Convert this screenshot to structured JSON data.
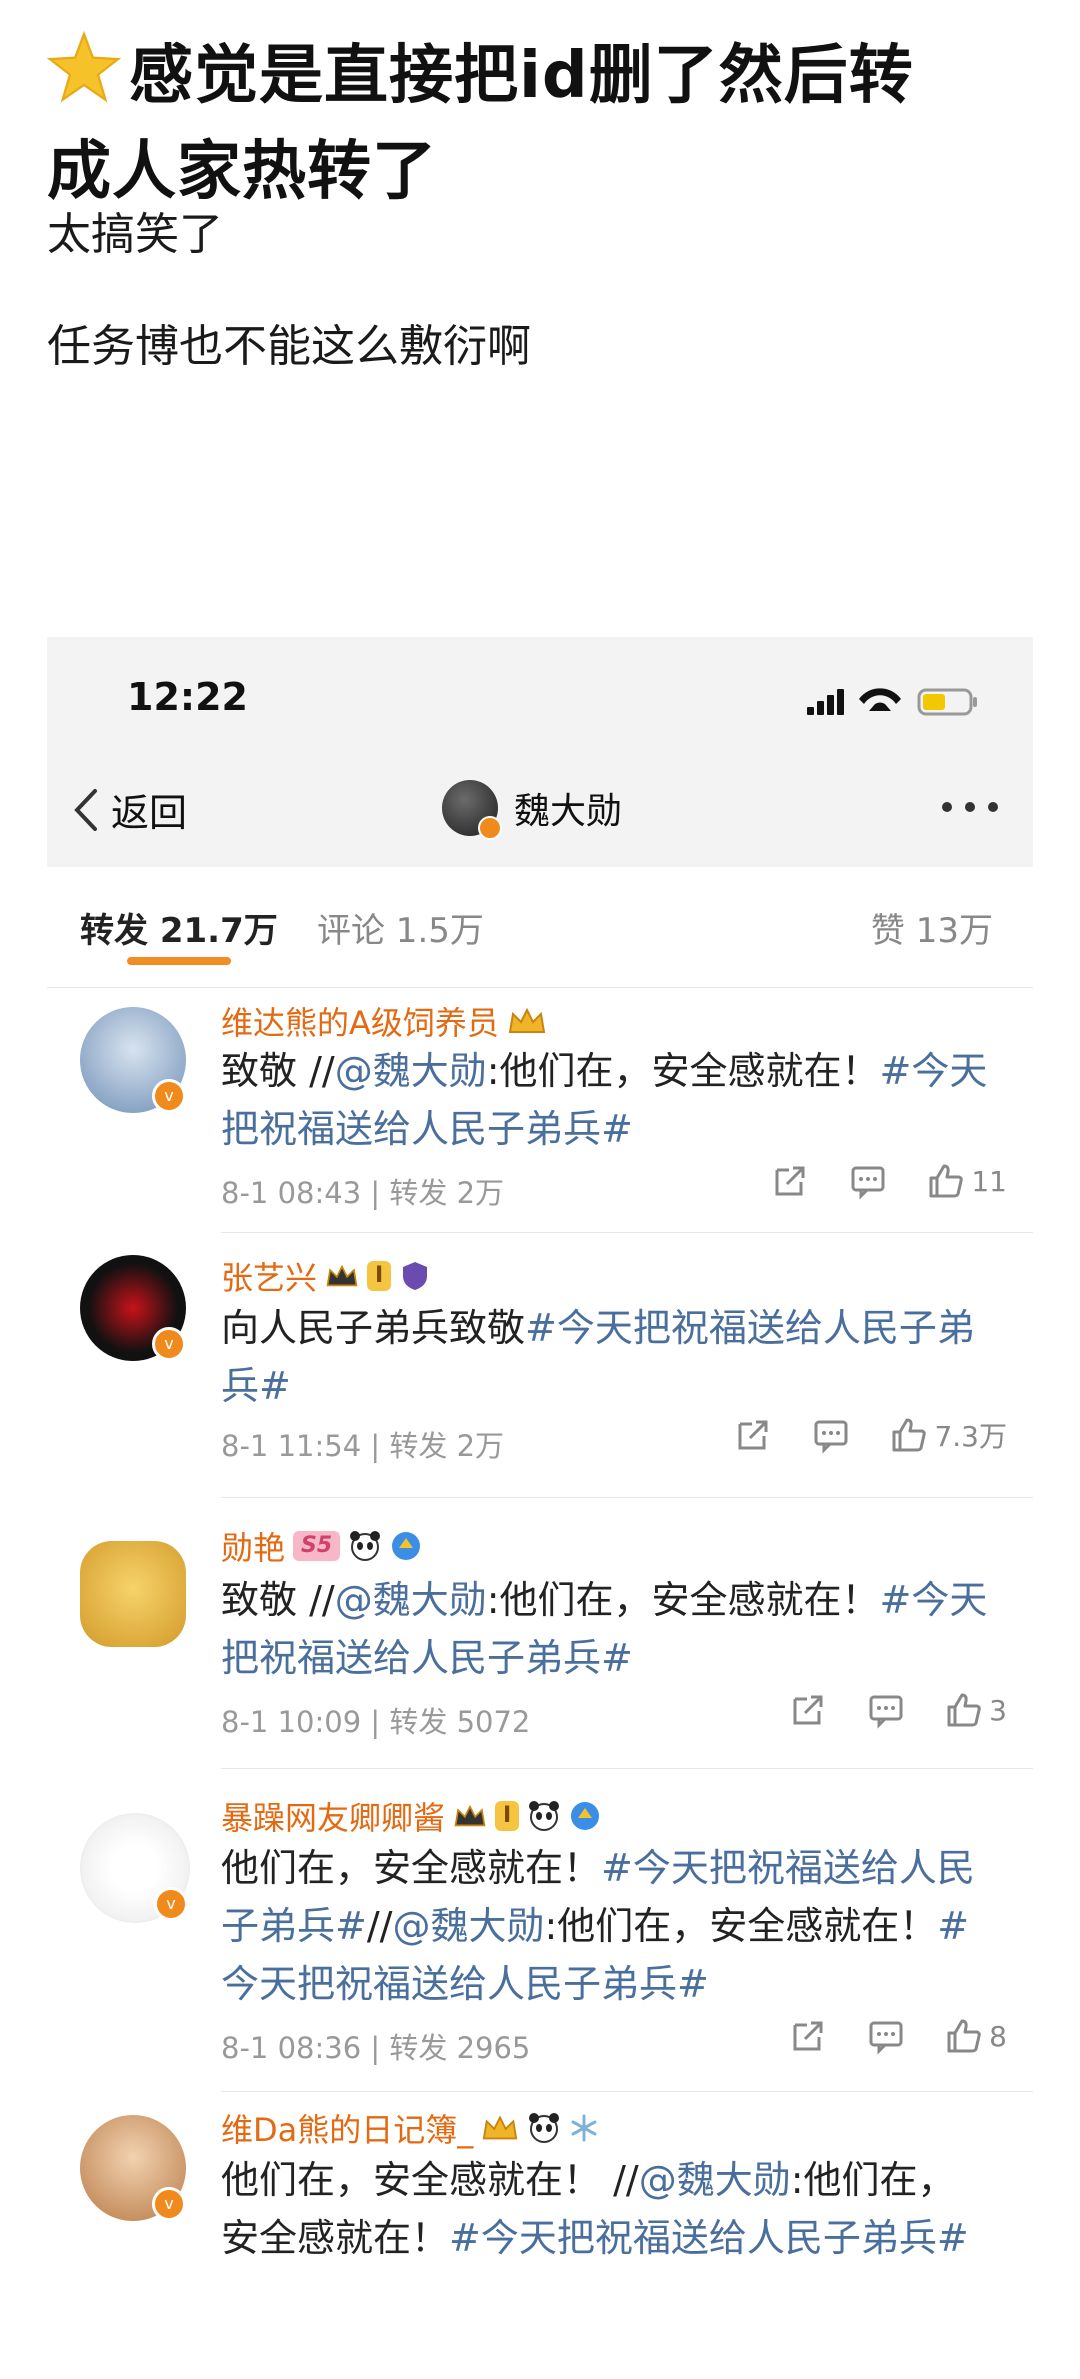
{
  "post": {
    "title_line1": "感觉是直接把id删了然后转",
    "title_line2": "成人家热转了",
    "line1": "太搞笑了",
    "line2": "任务博也不能这么敷衍啊"
  },
  "status_bar": {
    "time": "12:22"
  },
  "nav": {
    "back_label": "返回",
    "user_name": "魏大勋"
  },
  "tabs": {
    "repost": "转发 21.7万",
    "comment": "评论 1.5万",
    "like": "赞 13万"
  },
  "items": [
    {
      "name": "维达熊的A级饲养员",
      "body": [
        {
          "t": "致敬 //",
          "c": "n"
        },
        {
          "t": "@魏大勋",
          "c": "at"
        },
        {
          "t": ":他们在，安全感就在！",
          "c": "n"
        },
        {
          "t": "#今天把祝福送给人民子弟兵#",
          "c": "tag"
        }
      ],
      "meta": "8-1 08:43 | 转发 2万",
      "likes": "11"
    },
    {
      "name": "张艺兴",
      "badge": "I",
      "body": [
        {
          "t": "向人民子弟兵致敬",
          "c": "n"
        },
        {
          "t": "#今天把祝福送给人民子弟兵#",
          "c": "tag"
        }
      ],
      "meta": "8-1 11:54 | 转发 2万",
      "likes": "7.3万"
    },
    {
      "name": "勋艳",
      "badge": "S5",
      "body": [
        {
          "t": "致敬 //",
          "c": "n"
        },
        {
          "t": "@魏大勋",
          "c": "at"
        },
        {
          "t": ":他们在，安全感就在！",
          "c": "n"
        },
        {
          "t": "#今天把祝福送给人民子弟兵#",
          "c": "tag"
        }
      ],
      "meta": "8-1 10:09 | 转发 5072",
      "likes": "3"
    },
    {
      "name": "暴躁网友卿卿酱",
      "badge": "I",
      "body": [
        {
          "t": "他们在，安全感就在！",
          "c": "n"
        },
        {
          "t": "#今天把祝福送给人民子弟兵#",
          "c": "tag"
        },
        {
          "t": "//",
          "c": "n"
        },
        {
          "t": "@魏大勋",
          "c": "at"
        },
        {
          "t": ":他们在，安全感就在！",
          "c": "n"
        },
        {
          "t": "#今天把祝福送给人民子弟兵#",
          "c": "tag"
        }
      ],
      "meta": "8-1 08:36 | 转发 2965",
      "likes": "8"
    },
    {
      "name": "维Da熊的日记簿_",
      "body": [
        {
          "t": "他们在，安全感就在！ //",
          "c": "n"
        },
        {
          "t": "@魏大勋",
          "c": "at"
        },
        {
          "t": ":他们在，安全感就在！",
          "c": "n"
        },
        {
          "t": "#今天把祝福送给人民子弟兵#",
          "c": "tag"
        }
      ],
      "meta": "",
      "likes": ""
    }
  ],
  "colors": {
    "accent": "#f28c24",
    "name": "#e36a12",
    "link": "#4b6f9c",
    "verified": "#f08a1c"
  }
}
